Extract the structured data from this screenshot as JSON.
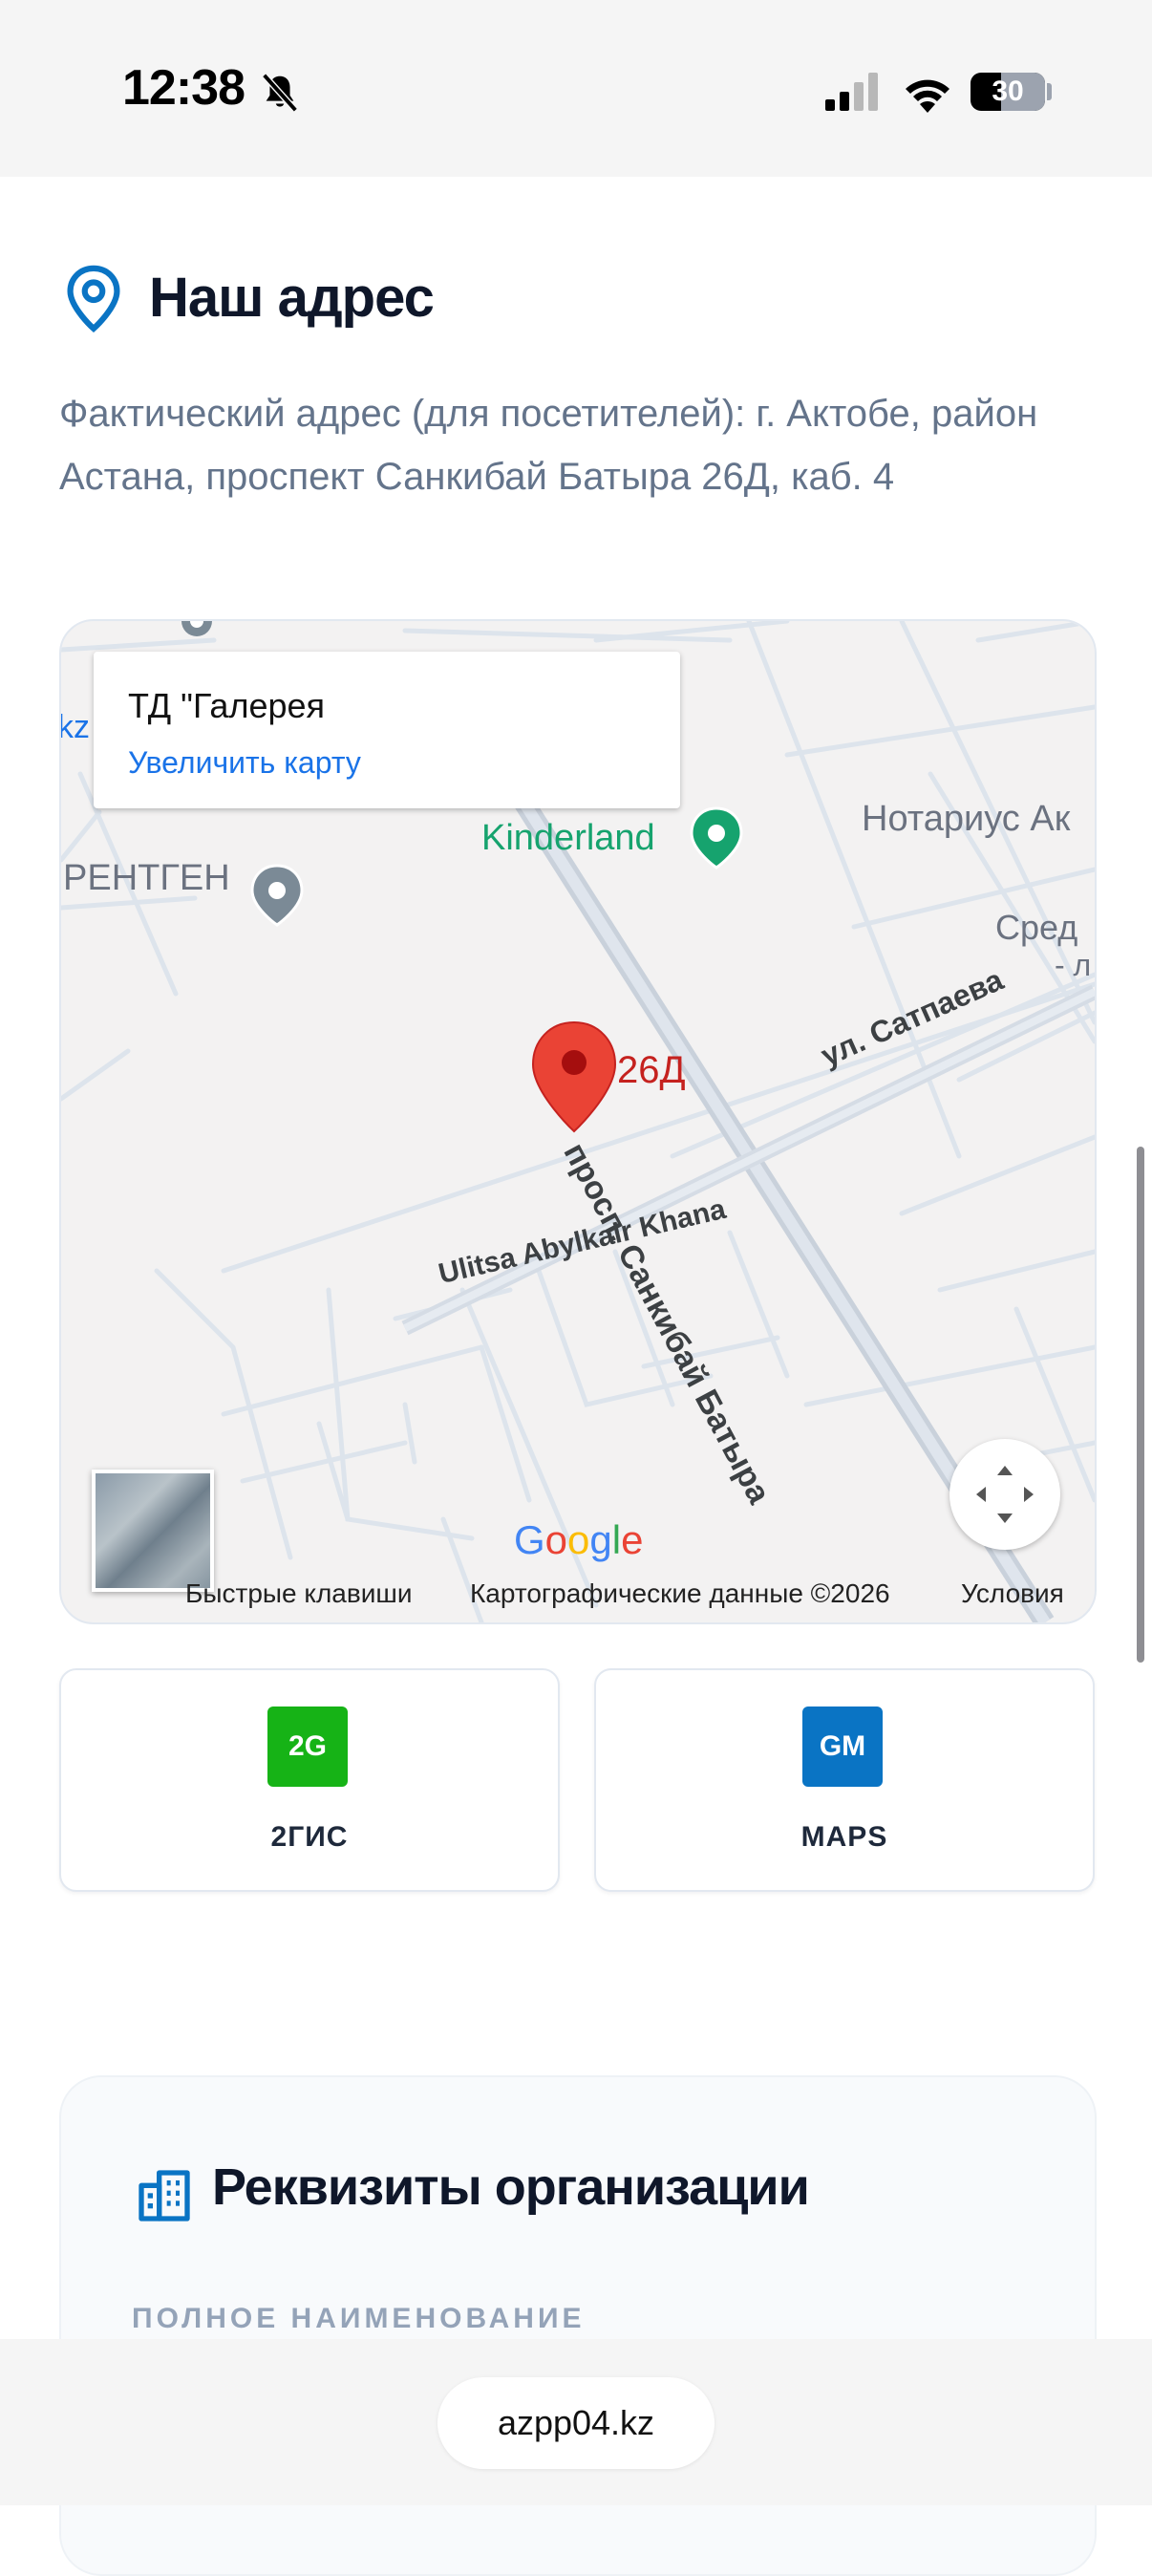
{
  "status_bar": {
    "time": "12:38",
    "battery": "30"
  },
  "address_section": {
    "title": "Наш адрес",
    "address": "Фактический адрес (для посетителей): г. Актобе, район Астана, проспект Санкибай Батыра 26Д, каб. 4"
  },
  "map": {
    "card_title": "ТД \"Галерея",
    "card_link": "Увеличить карту",
    "labels": {
      "edge_kz": "kz",
      "rentgen": "РЕНТГЕН",
      "kinderland": "Kinderland",
      "notarius": "Нотариус Ак",
      "sred": "Сред",
      "sred_dash": "- л",
      "marker": "26Д",
      "prosp": "просп. Санкибай Батыра",
      "satpaeva": "ул. Сатпаева",
      "abylkair": "Ulitsa Abylkair Khana"
    },
    "google": [
      "G",
      "o",
      "o",
      "g",
      "l",
      "e"
    ],
    "footer": {
      "shortcuts": "Быстрые клавиши",
      "data": "Картографические данные ©2026",
      "terms": "Условия"
    }
  },
  "nav_buttons": [
    {
      "badge": "2G",
      "label": "2ГИС",
      "color": "#16a34a"
    },
    {
      "badge": "GM",
      "label": "MAPS",
      "color": "#0a74c4"
    }
  ],
  "requisites": {
    "title": "Реквизиты организации",
    "first_label": "ПОЛНОЕ НАИМЕНОВАНИЕ"
  },
  "browser": {
    "url": "azpp04.kz"
  },
  "colors": {
    "accent": "#0a74c4",
    "text_dark": "#0f172a",
    "text_muted": "#64748b"
  }
}
